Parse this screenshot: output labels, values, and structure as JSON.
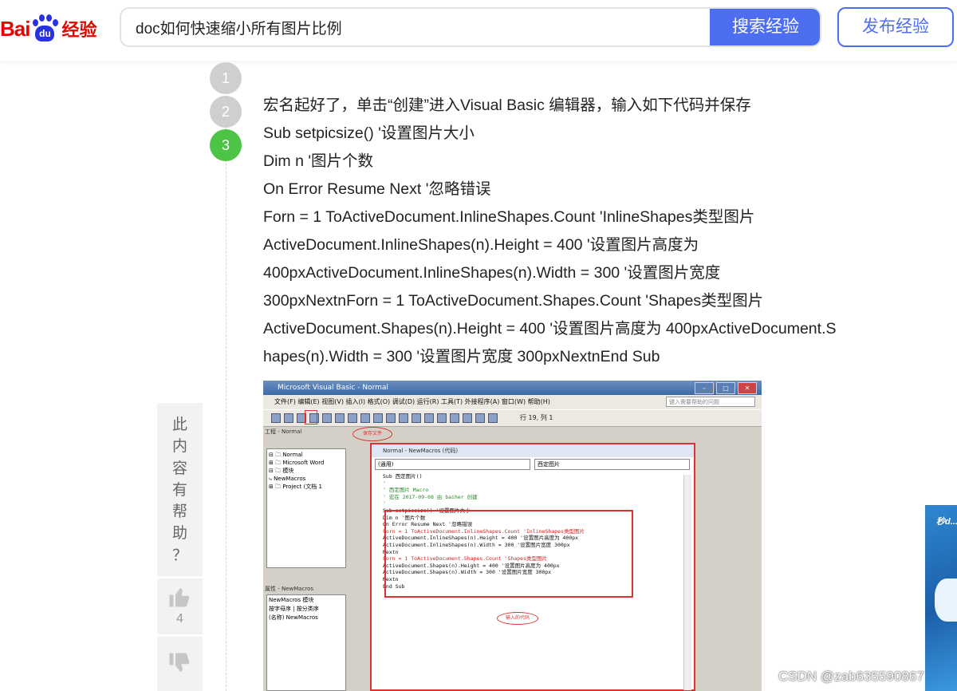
{
  "header": {
    "logo_bai": "Bai",
    "logo_du": "du",
    "logo_jingyan": "经验",
    "search_value": "doc如何快速缩小所有图片比例",
    "search_button": "搜索经验",
    "publish_button": "发布经验"
  },
  "steps": [
    {
      "number": "1",
      "state": "done"
    },
    {
      "number": "2",
      "state": "done"
    },
    {
      "number": "3",
      "state": "active"
    }
  ],
  "content": {
    "lines": [
      "宏名起好了，单击“创建”进入Visual Basic 编辑器，输入如下代码并保存",
      "Sub setpicsize() '设置图片大小",
      "Dim n '图片个数",
      "On Error Resume Next '忽略错误",
      "Forn = 1 ToActiveDocument.InlineShapes.Count 'InlineShapes类型图片",
      "ActiveDocument.InlineShapes(n).Height = 400 '设置图片高度为",
      "400pxActiveDocument.InlineShapes(n).Width = 300 '设置图片宽度",
      "300pxNextnForn = 1 ToActiveDocument.Shapes.Count 'Shapes类型图片",
      "ActiveDocument.Shapes(n).Height = 400 '设置图片高度为 400pxActiveDocument.S",
      "hapes(n).Width = 300 '设置图片宽度 300pxNextnEnd Sub"
    ]
  },
  "vba_screenshot": {
    "title": "Microsoft Visual Basic - Normal",
    "menu": "文件(F)   编辑(E)   视图(V)   插入(I)   格式(O)   调试(D)   运行(R)   工具(T)   外接程序(A)   窗口(W)   帮助(H)",
    "help_placeholder": "键入需要帮助的问题",
    "rowcol": "行 19, 列 1",
    "save_note": "保存文件",
    "project_title": "工程 - Normal",
    "project_tree": [
      "⊟ 🗀 Normal",
      "  ⊞ 🗀 Microsoft Word",
      "  ⊟ 🗀 模块",
      "      ⤷ NewMacros",
      "⊞ 🗀 Project (文档 1"
    ],
    "props_title": "属性 - NewMacros",
    "props_lines": [
      "NewMacros 模块",
      "按字母序 | 按分类序",
      "(名称)  NewMacros"
    ],
    "code_title": "Normal - NewMacros (代码)",
    "code_sel_left": "(通用)",
    "code_sel_right": "西定图片",
    "code_lines": [
      "Sub 西定图片()",
      "'",
      "' 西定图片 Macro",
      "' 宏在 2017-09-08 由 baiher 创建",
      "'",
      "",
      "Sub setpicsize() '设置图片大小",
      "Dim n '图片个数",
      "On Error Resume Next '忽略错误",
      "Forn = 1 ToActiveDocument.InlineShapes.Count 'InlineShapes类型图片",
      "ActiveDocument.InlineShapes(n).Height = 400 '设置图片高度为 400px",
      "ActiveDocument.InlineShapes(n).Width = 300 '设置图片宽度 300px",
      "Nextn",
      "Forn = 1 ToActiveDocument.Shapes.Count 'Shapes类型图片",
      "ActiveDocument.Shapes(n).Height = 400 '设置图片高度为 400px",
      "ActiveDocument.Shapes(n).Width = 300 '设置图片宽度 300px",
      "Nextn",
      "End Sub"
    ],
    "code_note": "输入的代码"
  },
  "feedback": {
    "helpful_chars": [
      "此",
      "内",
      "容",
      "有",
      "帮",
      "助",
      "？"
    ],
    "like_count": "4"
  },
  "ad": {
    "text": "秒d..."
  },
  "watermark": "CSDN @zab635590867",
  "colors": {
    "accent": "#4e6ef2",
    "step_active": "#4ec446",
    "brand_red": "#e10601",
    "brand_blue": "#2932e1"
  }
}
